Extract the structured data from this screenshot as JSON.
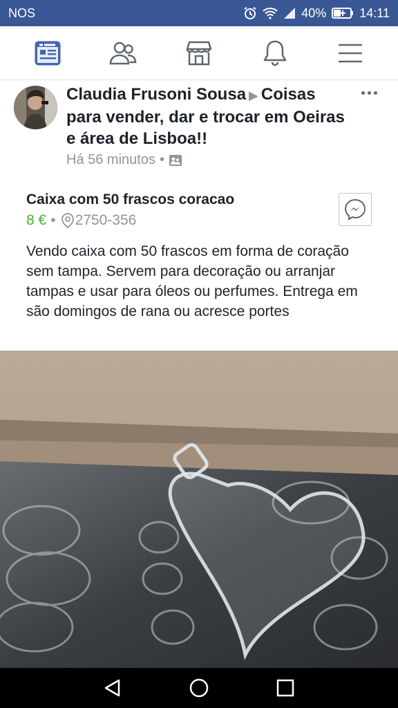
{
  "status_bar": {
    "carrier": "NOS",
    "battery": "40%",
    "time": "14:11"
  },
  "nav": {
    "icons": [
      "news-feed-icon",
      "friends-icon",
      "marketplace-icon",
      "notifications-icon",
      "menu-icon"
    ]
  },
  "post": {
    "author": "Claudia Frusoni Sousa",
    "group": "Coisas para vender, dar e trocar em Oeiras e área de Lisboa!!",
    "time": "Há 56 minutos",
    "separator": "•"
  },
  "item": {
    "title": "Caixa com 50 frascos coracao",
    "price": "8 €",
    "location": "2750-356",
    "description": "Vendo caixa com 50 frascos em forma de coração sem tampa. Servem para decoração ou arranjar tampas e usar para óleos ou perfumes. Entrega em são domingos de rana ou acresce portes"
  },
  "colors": {
    "status_bar": "#3a5795",
    "active_icon": "#4267b2",
    "price": "#42b72a",
    "muted": "#90949c"
  }
}
